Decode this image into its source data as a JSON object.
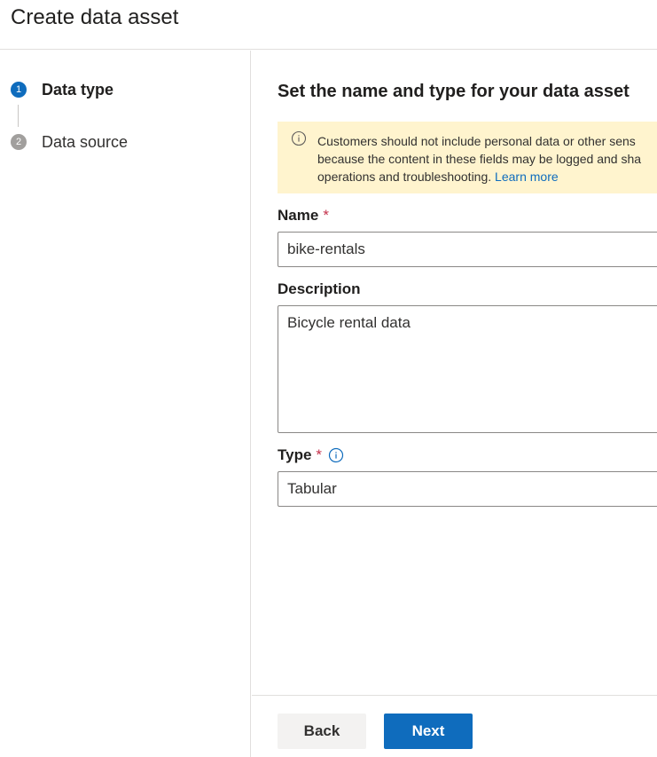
{
  "header": {
    "title": "Create data asset"
  },
  "wizard": {
    "steps": [
      {
        "number": "1",
        "label": "Data type",
        "state": "active"
      },
      {
        "number": "2",
        "label": "Data source",
        "state": "pending"
      }
    ]
  },
  "main": {
    "section_title": "Set the name and type for your data asset",
    "banner": {
      "line1": "Customers should not include personal data or other sens",
      "line2": "because the content in these fields may be logged and sha",
      "line3": "operations and troubleshooting.",
      "link": "Learn more",
      "icon": "info-icon"
    },
    "fields": {
      "name": {
        "label": "Name",
        "required_mark": "*",
        "value": "bike-rentals"
      },
      "description": {
        "label": "Description",
        "value": "Bicycle rental data"
      },
      "type": {
        "label": "Type",
        "required_mark": "*",
        "value": "Tabular",
        "icon": "info-icon"
      }
    }
  },
  "footer": {
    "back_label": "Back",
    "next_label": "Next"
  },
  "colors": {
    "accent": "#0f6cbd",
    "banner_background": "#fff4ce",
    "required": "#c4314b",
    "step_pending": "#a19f9d"
  }
}
